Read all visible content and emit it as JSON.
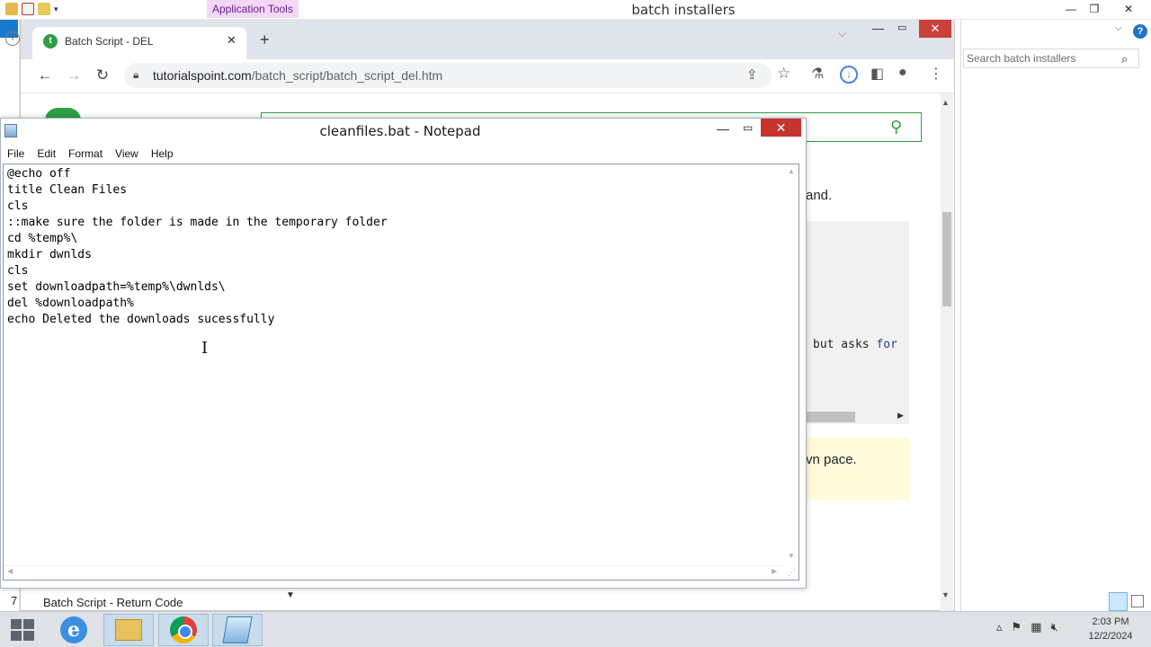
{
  "explorer": {
    "title": "batch installers",
    "app_tools_label": "Application Tools",
    "search_placeholder": "Search batch installers",
    "help_label": "?"
  },
  "chrome": {
    "tab_title": "Batch Script - DEL",
    "url_host": "tutorialspoint.com",
    "url_path": "/batch_script/batch_script_del.htm",
    "new_tab_label": "+",
    "tab_close_label": "✕"
  },
  "webpage": {
    "text_and": "and.",
    "code_fragment_1": "but asks ",
    "code_fragment_kw": "for",
    "note_fragment": "vn pace.",
    "bottom_number": "7",
    "bottom_heading": "Batch Script - Return Code"
  },
  "notepad": {
    "title": "cleanfiles.bat - Notepad",
    "menu": [
      "File",
      "Edit",
      "Format",
      "View",
      "Help"
    ],
    "content": "@echo off\ntitle Clean Files\ncls\n::make sure the folder is made in the temporary folder\ncd %temp%\\\nmkdir dwnlds\ncls\nset downloadpath=%temp%\\dwnlds\\\ndel %downloadpath%\necho Deleted the downloads sucessfully"
  },
  "taskbar": {
    "clock_time": "2:03 PM",
    "clock_date": "12/2/2024"
  },
  "colors": {
    "accent_green": "#2f9e44",
    "close_red": "#c7342e",
    "app_tools_bg": "#f3d7f7"
  }
}
